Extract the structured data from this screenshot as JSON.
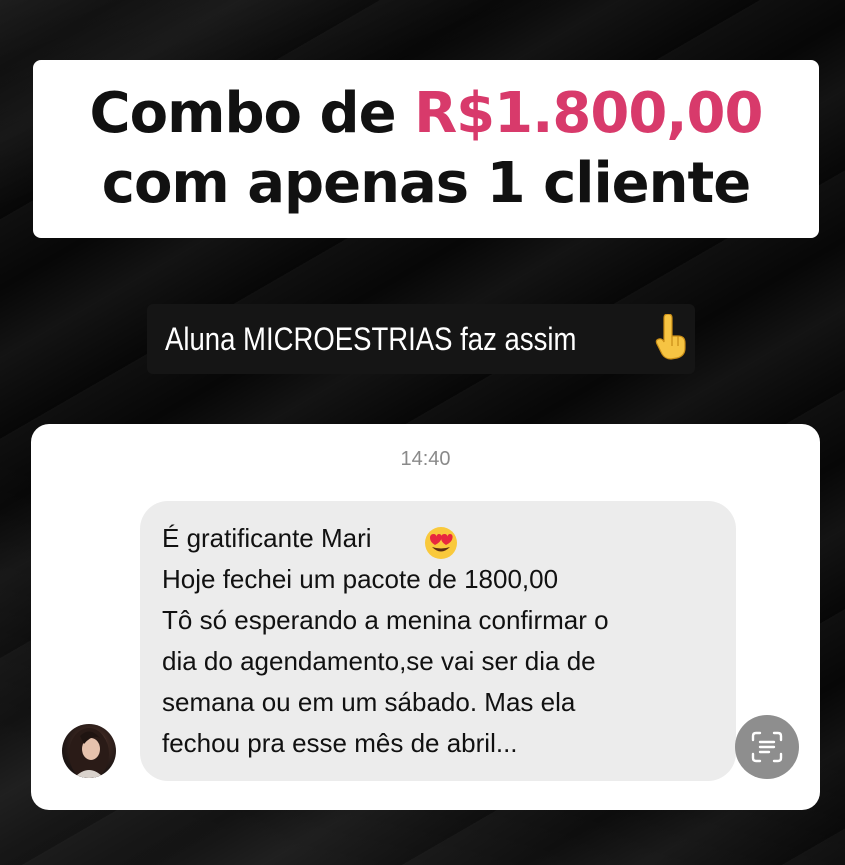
{
  "headline": {
    "line1_prefix": "Combo de ",
    "line1_amount": "R$1.800,00",
    "line2": "com apenas 1 cliente",
    "accent_color": "#d83a6b"
  },
  "subtitle": {
    "text": "Aluna MICROESTRIAS faz assim",
    "emoji": "backhand-index-pointing-down"
  },
  "chat": {
    "timestamp": "14:40",
    "message_lines": [
      "É gratificante Mari",
      "Hoje fechei um pacote de 1800,00",
      "Tô só esperando a menina confirmar o",
      "dia do agendamento,se vai ser dia de",
      "semana ou em um sábado. Mas ela",
      "fechou pra esse mês de abril..."
    ],
    "inline_emoji": "heart-eyes",
    "action_icon": "text-scan-icon"
  }
}
